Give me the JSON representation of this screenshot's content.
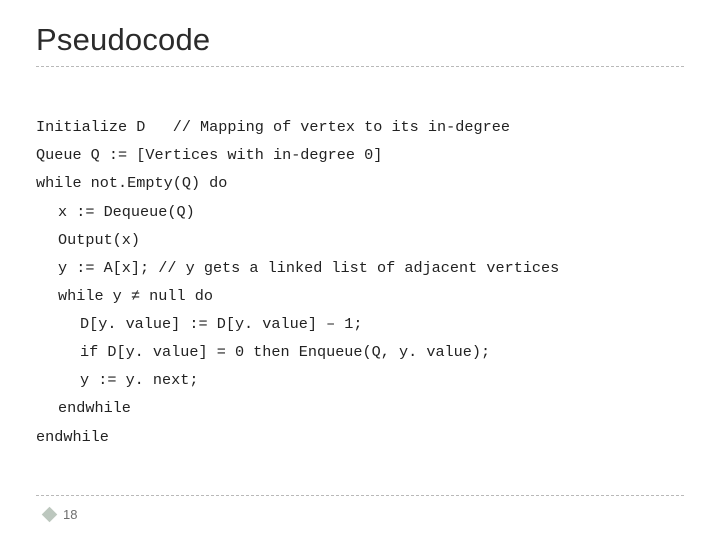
{
  "title": "Pseudocode",
  "code": {
    "l0": "Initialize D   // Mapping of vertex to its in-degree",
    "l1": "Queue Q := [Vertices with in-degree 0]",
    "l2": "while not.Empty(Q) do",
    "l3": "x := Dequeue(Q)",
    "l4": "Output(x)",
    "l5": "y := A[x]; // y gets a linked list of adjacent vertices",
    "l6": "while y ≠ null do",
    "l7": "D[y. value] := D[y. value] – 1;",
    "l8": "if D[y. value] = 0 then Enqueue(Q, y. value);",
    "l9": "y := y. next;",
    "l10": "endwhile",
    "l11": "endwhile"
  },
  "page_number": "18"
}
